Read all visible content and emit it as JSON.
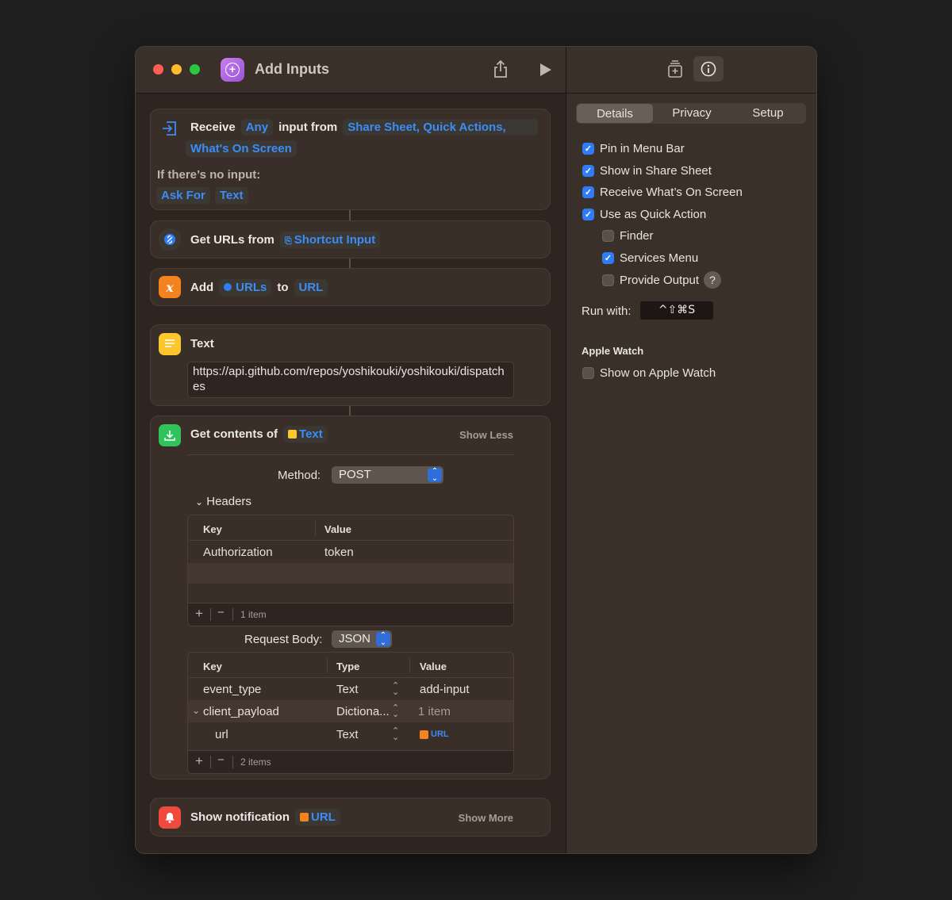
{
  "window": {
    "title": "Add Inputs"
  },
  "receive_card": {
    "receive_label": "Receive",
    "type_token": "Any",
    "input_from_label": "input from",
    "sources_token_line1": "Share Sheet, Quick Actions,",
    "sources_token_line2": "What's On Screen",
    "no_input_label": "If there’s no input:",
    "ask_for_token": "Ask For",
    "text_token": "Text"
  },
  "get_urls_card": {
    "label": "Get URLs from",
    "input_token": "Shortcut Input"
  },
  "add_card": {
    "label": "Add",
    "urls_token": "URLs",
    "to_label": "to",
    "var_token": "URL"
  },
  "text_card": {
    "title": "Text",
    "content": "https://api.github.com/repos/yoshikouki/yoshikouki/dispatches"
  },
  "get_contents_card": {
    "label": "Get contents of",
    "text_token": "Text",
    "show_less": "Show Less",
    "method_label": "Method:",
    "method_value": "POST",
    "headers_label": "Headers",
    "headers_table": {
      "columns": [
        "Key",
        "Value"
      ],
      "rows": [
        {
          "key": "Authorization",
          "value": "token"
        }
      ],
      "footer_count": "1 item"
    },
    "request_body_label": "Request Body:",
    "request_body_value": "JSON",
    "body_table": {
      "columns": [
        "Key",
        "Type",
        "Value"
      ],
      "rows": [
        {
          "key": "event_type",
          "type": "Text",
          "value": "add-input"
        },
        {
          "key": "client_payload",
          "type": "Dictiona...",
          "value": "1 item"
        },
        {
          "key": "url",
          "type": "Text",
          "value": "URL"
        }
      ],
      "footer_count": "2 items"
    }
  },
  "notification_card": {
    "label": "Show notification",
    "token": "URL",
    "show_more": "Show More"
  },
  "details_panel": {
    "tabs": [
      "Details",
      "Privacy",
      "Setup"
    ],
    "checkboxes": [
      {
        "label": "Pin in Menu Bar",
        "checked": true
      },
      {
        "label": "Show in Share Sheet",
        "checked": true
      },
      {
        "label": "Receive What’s On Screen",
        "checked": true
      },
      {
        "label": "Use as Quick Action",
        "checked": true
      },
      {
        "label": "Finder",
        "checked": false
      },
      {
        "label": "Services Menu",
        "checked": true
      },
      {
        "label": "Provide Output",
        "checked": false
      }
    ],
    "run_with_label": "Run with:",
    "shortcut": "^⇧⌘S",
    "apple_watch_heading": "Apple Watch",
    "apple_watch_checkbox": {
      "label": "Show on Apple Watch",
      "checked": false
    }
  },
  "colors": {
    "accent_blue": "#2f7cf6",
    "token_blue": "#3d8cf5",
    "close": "#ff5f57",
    "minimize": "#febc2e",
    "zoom": "#28c840"
  },
  "icons": {
    "receive": "input-arrow-icon",
    "get_urls": "link-icon",
    "add": "variable-x-icon",
    "text": "text-lines-icon",
    "get_contents": "download-icon",
    "notification": "bell-icon"
  }
}
